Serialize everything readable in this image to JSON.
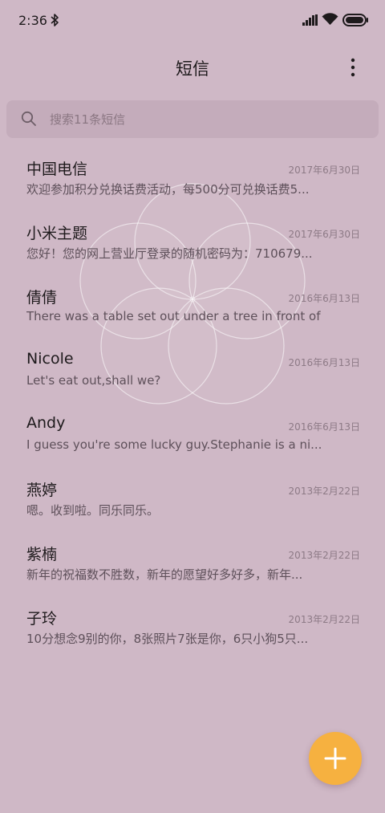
{
  "status_bar": {
    "time": "2:36",
    "icons": [
      "bluetooth-icon",
      "signal-icon",
      "wifi-icon",
      "battery-icon"
    ]
  },
  "header": {
    "title": "短信",
    "menu_icon": "more-vertical-icon"
  },
  "search": {
    "placeholder": "搜索11条短信",
    "value": "",
    "icon": "search-icon"
  },
  "messages": [
    {
      "name": "中国电信",
      "date": "2017年6月30日",
      "preview": "欢迎参加积分兑换话费活动，每500分可兑换话费5..."
    },
    {
      "name": "小米主题",
      "date": "2017年6月30日",
      "preview": "您好！您的网上营业厅登录的随机密码为：710679..."
    },
    {
      "name": "倩倩",
      "date": "2016年6月13日",
      "preview": "There was a table set out under a tree in front of ..."
    },
    {
      "name": "Nicole",
      "date": "2016年6月13日",
      "preview": "Let's eat out,shall we?"
    },
    {
      "name": "Andy",
      "date": "2016年6月13日",
      "preview": "I guess you're some lucky guy.Stephanie is a ni..."
    },
    {
      "name": "燕婷",
      "date": "2013年2月22日",
      "preview": "嗯。收到啦。同乐同乐。"
    },
    {
      "name": "紫楠",
      "date": "2013年2月22日",
      "preview": "新年的祝福数不胜数，新年的愿望好多好多，新年..."
    },
    {
      "name": "子玲",
      "date": "2013年2月22日",
      "preview": "10分想念9别的你，8张照片7张是你，6只小狗5只..."
    }
  ],
  "fab": {
    "icon": "plus-icon",
    "color": "#f6b140"
  },
  "colors": {
    "background": "#cfb8c6",
    "search_bg": "#c4acbb",
    "accent": "#f6b140"
  }
}
